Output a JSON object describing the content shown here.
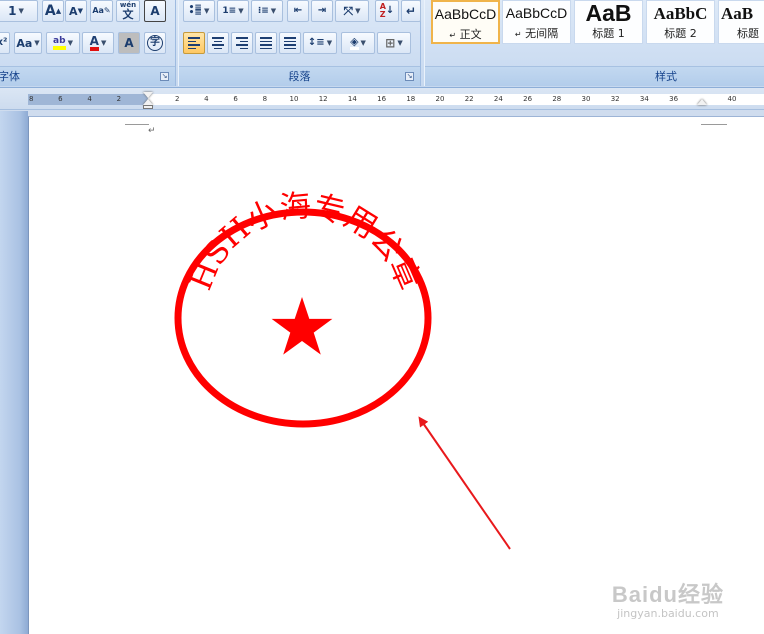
{
  "ribbon": {
    "font_group": {
      "caption": "字体",
      "grow_font": "A",
      "shrink_font": "A",
      "wen_label": "wén",
      "wen_char": "文",
      "char_border": "A",
      "clear_format": "Aa",
      "font_color": "A",
      "char_shading": "A",
      "enclose_char": "字",
      "size_value": "1"
    },
    "paragraph_group": {
      "caption": "段落"
    },
    "styles_group": {
      "caption": "样式",
      "tiles": [
        {
          "sample": "AaBbCcD",
          "name": "正文",
          "mark": "↵"
        },
        {
          "sample": "AaBbCcD",
          "name": "无间隔",
          "mark": "↵"
        },
        {
          "sample": "AaB",
          "name": "标题 1",
          "mark": ""
        },
        {
          "sample": "AaBbC",
          "name": "标题 2",
          "mark": ""
        },
        {
          "sample": "AaB",
          "name": "标题",
          "mark": ""
        }
      ]
    }
  },
  "ruler": {
    "left_labels": [
      "8",
      "6",
      "4",
      "2"
    ],
    "right_labels": [
      "2",
      "4",
      "6",
      "8",
      "10",
      "12",
      "14",
      "16",
      "18",
      "20",
      "22",
      "24",
      "26",
      "28",
      "30",
      "32",
      "34",
      "36",
      "",
      "40"
    ]
  },
  "document": {
    "paragraph_mark": "↵",
    "seal": {
      "text": "HSH小海专用公章",
      "color": "#ff0000"
    },
    "arrow_color": "#e8191c"
  },
  "watermark": {
    "brand": "Baidu经验",
    "url": "jingyan.baidu.com"
  }
}
